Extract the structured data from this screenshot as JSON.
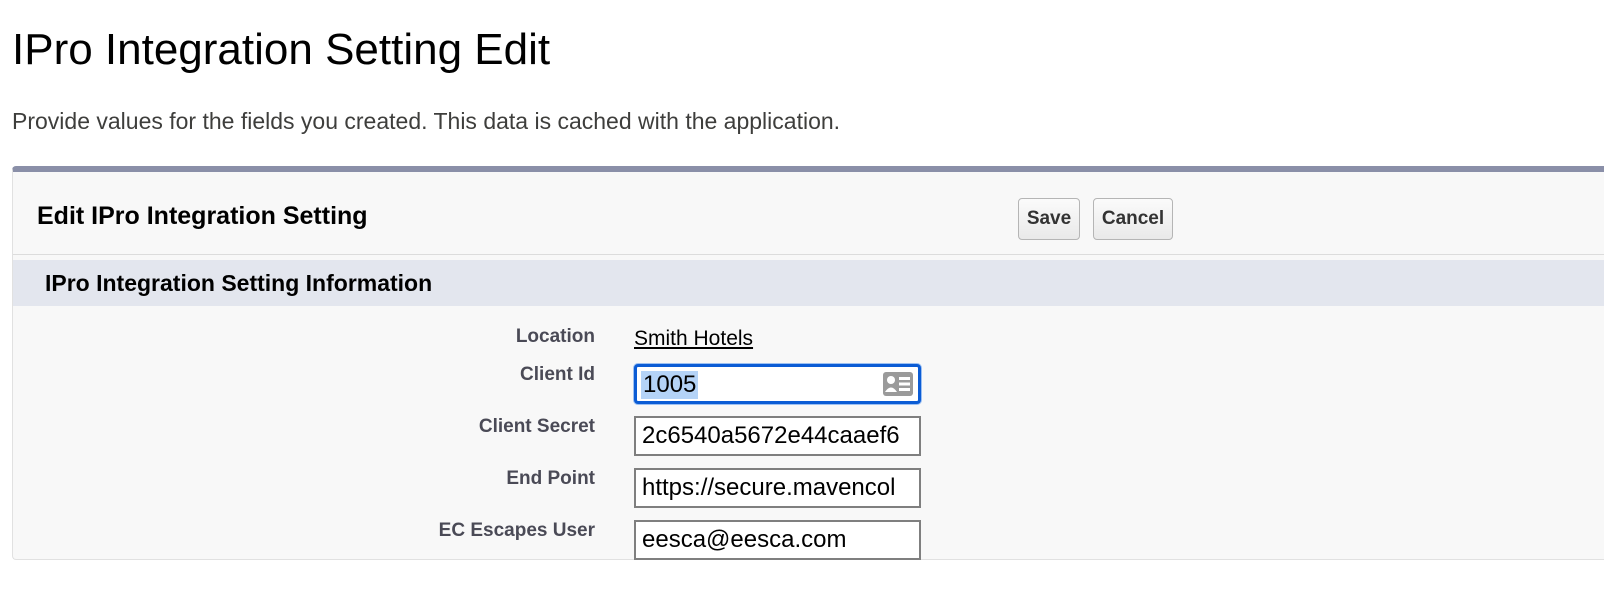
{
  "page": {
    "title": "IPro Integration Setting Edit",
    "description": "Provide values for the fields you created. This data is cached with the application."
  },
  "panel": {
    "title": "Edit IPro Integration Setting",
    "save_label": "Save",
    "cancel_label": "Cancel",
    "section_title": "IPro Integration Setting Information"
  },
  "fields": {
    "location": {
      "label": "Location",
      "value": "Smith Hotels"
    },
    "client_id": {
      "label": "Client Id",
      "value": "1005",
      "icon": "contact-card-icon"
    },
    "client_secret": {
      "label": "Client Secret",
      "value": "2c6540a5672e44caaef6"
    },
    "end_point": {
      "label": "End Point",
      "value": "https://secure.mavencol"
    },
    "ec_escapes_user": {
      "label": "EC Escapes User",
      "value": "eesca@eesca.com"
    }
  },
  "colors": {
    "focus_border": "#0b5cd5",
    "selection": "#b4d3f7",
    "section_bg": "#e3e6ee",
    "panel_top_border": "#8a8fa8"
  }
}
